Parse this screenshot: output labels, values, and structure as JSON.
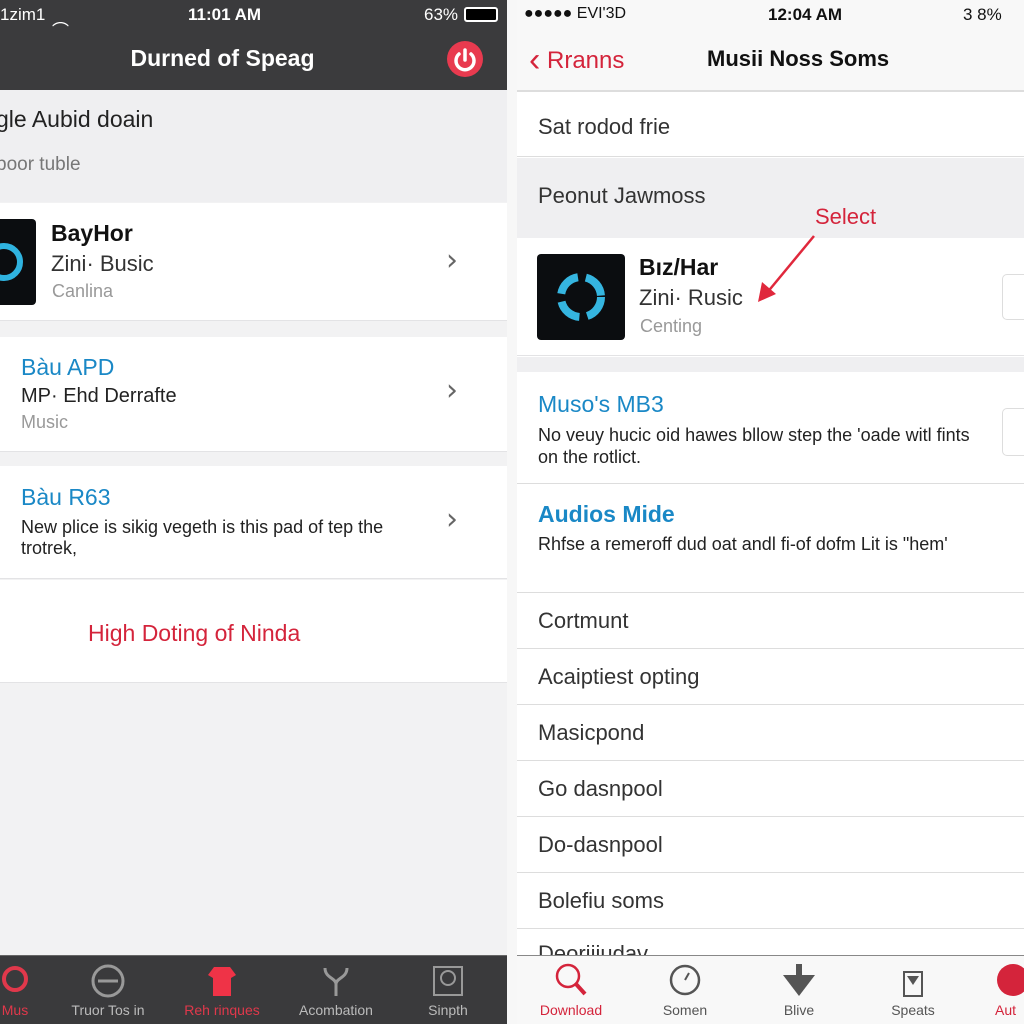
{
  "left": {
    "status": {
      "carrier": "1zim1",
      "time": "11:01 AM",
      "battery": "63%"
    },
    "nav": {
      "title": "Durned of Speag",
      "power_icon": "power-icon"
    },
    "header": {
      "title": "gle Aubid doain",
      "subtitle": "poor tuble"
    },
    "items": [
      {
        "title": "BayHor",
        "subtitle": "Zini· Busic",
        "meta": "Canlina"
      },
      {
        "title": "Bàu APD",
        "subtitle": "MP· Ehd Derrafte",
        "meta": "Music"
      },
      {
        "title": "Bàu R63",
        "subtitle": "New plice is sikig vegeth is this pad of tep the trotrek,"
      }
    ],
    "action": "High Doting of Ninda",
    "tabs": [
      {
        "label": "Mus",
        "active": true
      },
      {
        "label": "Truor Tos in"
      },
      {
        "label": "Reh rinques",
        "active": true
      },
      {
        "label": "Acombation"
      },
      {
        "label": "Sinpth"
      }
    ]
  },
  "right": {
    "status": {
      "carrier": "●●●●● EVI'3D",
      "time": "12:04 AM",
      "battery": "3 8%"
    },
    "nav": {
      "back": "Rranns",
      "title": "Musii Noss Soms"
    },
    "row1": "Sat rodod frie",
    "section": "Peonut Jawmoss",
    "annotation": "Select",
    "featured": {
      "title": "Bız/Har",
      "subtitle": "Zini· Rusic",
      "meta": "Centing"
    },
    "items": [
      {
        "title": "Muso's MB3",
        "subtitle": "No veuy hucic oid hawes bllow step the 'oade witl fints on the rotlict."
      },
      {
        "title": "Audios Mide",
        "subtitle": "Rhfse a remeroff dud oat andl fi-of dofm Lit is \"hem'"
      }
    ],
    "rows": [
      "Cortmunt",
      "Acaiptiest opting",
      "Masicpond",
      "Go dasnpool",
      "Do-dasnpool",
      "Bolefiu soms",
      "Deorijiudav"
    ],
    "tabs": [
      {
        "label": "Download",
        "active": true
      },
      {
        "label": "Somen"
      },
      {
        "label": "Blive"
      },
      {
        "label": "Speats"
      },
      {
        "label": "Aut",
        "active": true
      }
    ]
  },
  "colors": {
    "accent": "#d4243b",
    "link": "#1a88c6",
    "dark_bar": "#3a3a3c"
  }
}
